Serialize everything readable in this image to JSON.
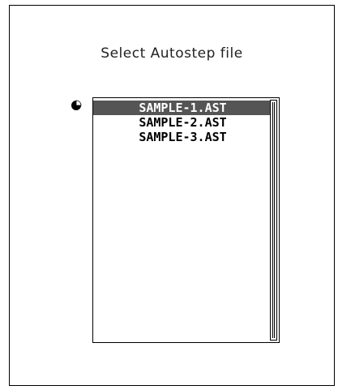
{
  "dialog": {
    "title": "Select Autostep file"
  },
  "file_list": {
    "items": [
      {
        "label": "SAMPLE-1.AST",
        "selected": true
      },
      {
        "label": "SAMPLE-2.AST",
        "selected": false
      },
      {
        "label": "SAMPLE-3.AST",
        "selected": false
      }
    ]
  },
  "colors": {
    "selection_bg": "#555555",
    "selection_fg": "#ffffff"
  },
  "icons": {
    "pointer": "selection-pointer-icon"
  }
}
